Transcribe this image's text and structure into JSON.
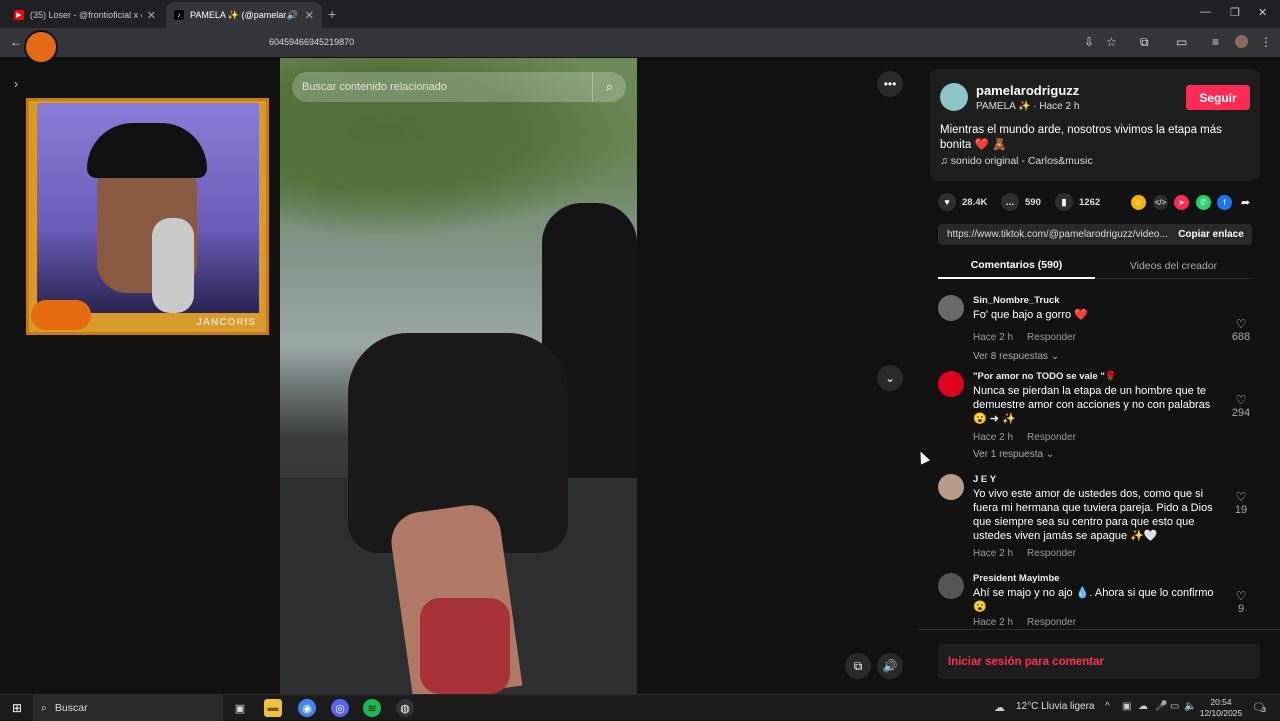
{
  "browser": {
    "tabs": [
      {
        "title": "(35) Loser - @frontioficial x @h",
        "favicon": "youtube-icon",
        "color": "#ff0000"
      },
      {
        "title": "PAMELA ✨ (@pamelarodriguzz)",
        "favicon": "tiktok-icon",
        "color": "#000000"
      }
    ],
    "new_tab": "+",
    "url": "604594669452198​70"
  },
  "video": {
    "search_placeholder": "Buscar contenido relacionado"
  },
  "overlay": {
    "streamer_name": "JANCORIS"
  },
  "creator": {
    "username": "pamelarodriguzz",
    "nickname_line": "PAMELA ✨ · Hace 2 h",
    "follow_label": "Seguir",
    "caption": "Mientras el mundo arde, nosotros vivimos la etapa más bonita ❤️ 🧸",
    "sound": "♫  sonido original - Carlos&music"
  },
  "stats": {
    "likes": "28.4K",
    "comments": "590",
    "saves": "1262"
  },
  "link": {
    "url": "https://www.tiktok.com/@pamelarodriguzz/video...",
    "copy_label": "Copiar enlace"
  },
  "panel_tabs": {
    "comments": "Comentarios (590)",
    "creator_videos": "Videos del creador"
  },
  "comments": [
    {
      "user": "Sin_Nombre_Truck",
      "text": "Fo' que bajo a gorro ❤️",
      "time": "Hace 2 h",
      "reply": "Responder",
      "more": "Ver 8 respuestas ⌄",
      "likes": "688",
      "avatar_color": "#6a6a6a"
    },
    {
      "user": "\"Por amor no TODO se vale \"🌹",
      "text": "Nunca se pierdan la etapa de un hombre que te demuestre amor con acciones y no con palabras 😮 ➜ ✨",
      "time": "Hace 2 h",
      "reply": "Responder",
      "more": "Ver 1 respuesta ⌄",
      "likes": "294",
      "avatar_color": "#e0001b"
    },
    {
      "user": "J E Y",
      "text": "Yo vivo este amor de ustedes dos, como que si fuera mi hermana que tuviera pareja. Pido a Dios que siempre sea su centro para que esto que ustedes viven jamás se apague ✨🤍",
      "time": "Hace 2 h",
      "reply": "Responder",
      "more": "",
      "likes": "19",
      "avatar_color": "#b69a8a"
    },
    {
      "user": "President Mayimbe",
      "text": "Ahí se majo y no ajo 💧. Ahora si que lo confirmo 😮",
      "time": "Hace 2 h",
      "reply": "Responder",
      "more": "",
      "likes": "9",
      "avatar_color": "#555555"
    }
  ],
  "login_prompt": "Iniciar sesión para comentar",
  "taskbar": {
    "search": "Buscar",
    "weather": "12°C  Lluvia ligera",
    "time": "20:54",
    "date": "12/10/2025",
    "notif_count": "3"
  },
  "colors": {
    "accent": "#fe2c55",
    "background": "#121212"
  }
}
